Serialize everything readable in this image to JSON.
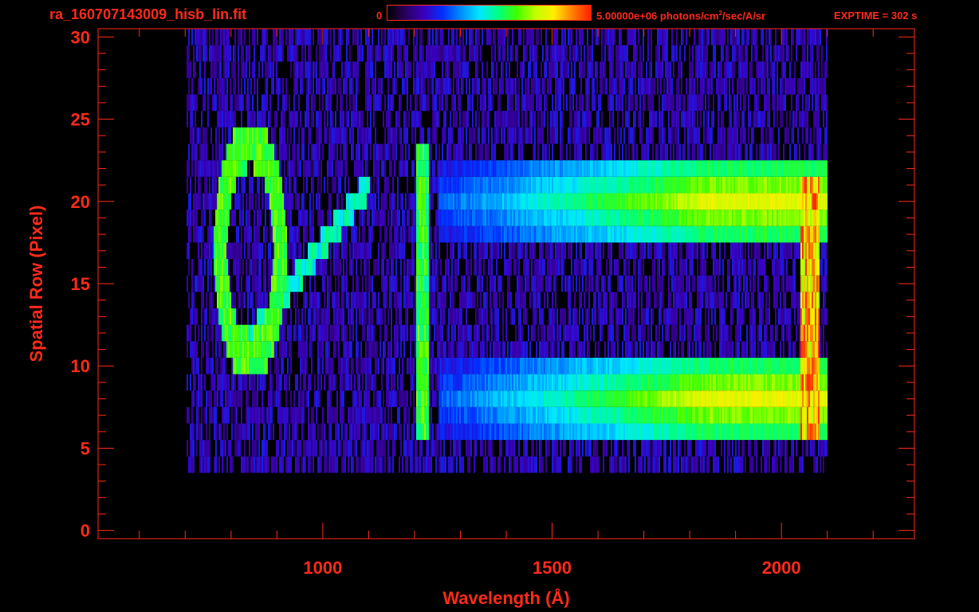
{
  "header": {
    "title": "ra_160707143009_hisb_lin.fit",
    "colorbar_min": "0",
    "colorbar_max_value": "5.00000e+06 photons/cm",
    "colorbar_max_sup": "2",
    "colorbar_max_rest": "/sec/A/sr",
    "exptime": "EXPTIME = 302 s"
  },
  "colors": {
    "axis": "#ff2a1a",
    "background": "#000000",
    "colormap": [
      "#000000",
      "#2a0060",
      "#3a00c0",
      "#0030ff",
      "#0090ff",
      "#00e8ff",
      "#00ff80",
      "#40ff00",
      "#c0ff00",
      "#ffee00",
      "#ff8000",
      "#ff2000"
    ]
  },
  "chart_data": {
    "type": "heatmap",
    "title": "ra_160707143009_hisb_lin.fit",
    "xlabel": "Wavelength (Å)",
    "ylabel": "Spatial Row (Pixel)",
    "xlim": [
      510,
      2290
    ],
    "ylim": [
      -0.5,
      30.5
    ],
    "xticks": [
      1000,
      1500,
      2000
    ],
    "yticks": [
      0,
      5,
      10,
      15,
      20,
      25,
      30
    ],
    "colorbar_range": [
      0,
      5000000
    ],
    "colorbar_units": "photons/cm^2/sec/A/sr",
    "exptime_s": 302,
    "data_extent_x": [
      700,
      2100
    ],
    "features": [
      {
        "name": "broad band",
        "rows": [
          18,
          22
        ],
        "x_range": [
          1250,
          2070
        ],
        "peak": 0.8
      },
      {
        "name": "broad band",
        "rows": [
          6,
          10
        ],
        "x_range": [
          1250,
          2070
        ],
        "peak": 0.8
      },
      {
        "name": "ring",
        "center_x": 840,
        "center_y": 17,
        "rx": 65,
        "ry": 6.5
      },
      {
        "name": "line",
        "x": 1216,
        "rows": [
          6,
          23
        ]
      },
      {
        "name": "diagonal arm",
        "from": [
          820,
          11
        ],
        "to": [
          1100,
          21
        ]
      }
    ]
  }
}
